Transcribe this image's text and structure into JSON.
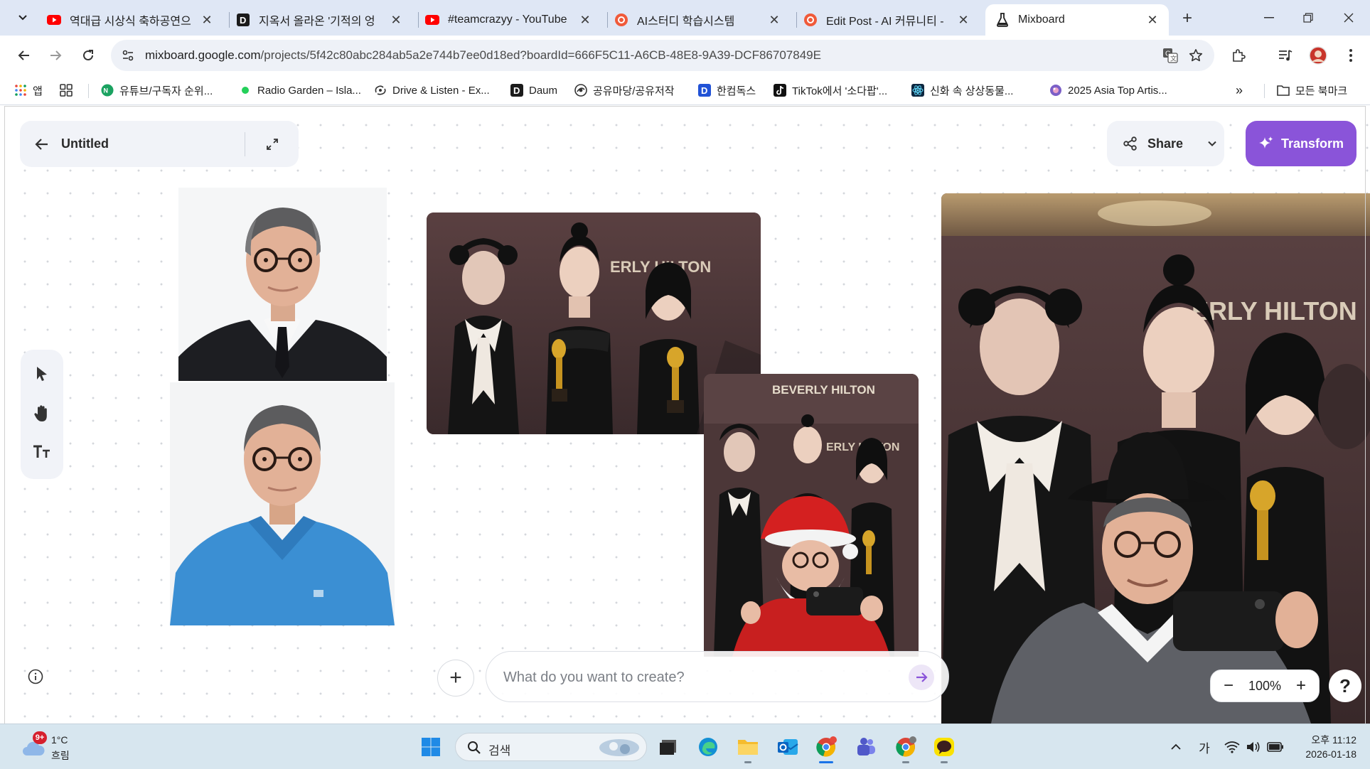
{
  "browser": {
    "tabs": [
      {
        "title": "역대급 시상식 축하공연으",
        "favicon": "youtube-icon"
      },
      {
        "title": "지옥서 올라온 '기적의 엉",
        "favicon": "daum-icon"
      },
      {
        "title": "#teamcrazyy - YouTube",
        "favicon": "youtube-icon"
      },
      {
        "title": "AI스터디 학습시스템",
        "favicon": "aistudy-icon"
      },
      {
        "title": "Edit Post - AI 커뮤니티 -",
        "favicon": "aistudy-icon"
      },
      {
        "title": "Mixboard",
        "favicon": "flask-icon",
        "active": true
      }
    ],
    "url_host": "mixboard.google.com",
    "url_path": "/projects/5f42c80abc284ab5a2e744b7ee0d18ed?boardId=666F5C11-A6CB-48E8-9A39-DCF86707849E",
    "bookmarks": [
      {
        "label": "앱",
        "icon": "apps-grid-icon"
      },
      {
        "label": "",
        "icon": "tab-groups-icon"
      },
      {
        "label": "유튜브/구독자 순위...",
        "icon": "green-circle-icon"
      },
      {
        "label": "Radio Garden – Isla...",
        "icon": "green-dot-icon"
      },
      {
        "label": "Drive & Listen - Ex...",
        "icon": "drive-icon"
      },
      {
        "label": "Daum",
        "icon": "daum-icon"
      },
      {
        "label": "공유마당/공유저작",
        "icon": "share-site-icon"
      },
      {
        "label": "한컴독스",
        "icon": "hancom-icon"
      },
      {
        "label": "TikTok에서 '소다팝'...",
        "icon": "tiktok-icon"
      },
      {
        "label": "신화 속 상상동물...",
        "icon": "react-icon"
      },
      {
        "label": "2025 Asia Top Artis...",
        "icon": "globe-icon"
      }
    ],
    "all_bookmarks_label": "모든 북마크"
  },
  "app": {
    "board_title": "Untitled",
    "share_label": "Share",
    "transform_label": "Transform",
    "prompt_placeholder": "What do you want to create?",
    "zoom_level": "100%",
    "help_label": "?",
    "canvas_images": [
      {
        "name": "portrait-suit",
        "desc": "man in glasses wearing black suit"
      },
      {
        "name": "portrait-polo",
        "desc": "man in glasses wearing blue polo"
      },
      {
        "name": "group-photo-original",
        "sign_text": "ERLY HILTON"
      },
      {
        "name": "group-photo-santa",
        "sign_text": "BEVERLY HILTON",
        "sign_text_2": "ERLY HILTON"
      },
      {
        "name": "group-photo-hanbok",
        "sign_text": "ERLY HILTON"
      }
    ]
  },
  "taskbar": {
    "weather_temp": "1°C",
    "weather_cond": "흐림",
    "weather_badge": "9+",
    "search_label": "검색",
    "ime_label": "가",
    "time": "오후 11:12",
    "date": "2026-01-18"
  },
  "colors": {
    "accent": "#8a54d9",
    "tabbar": "#dfe7f5",
    "taskbar": "#d7e6ef"
  }
}
